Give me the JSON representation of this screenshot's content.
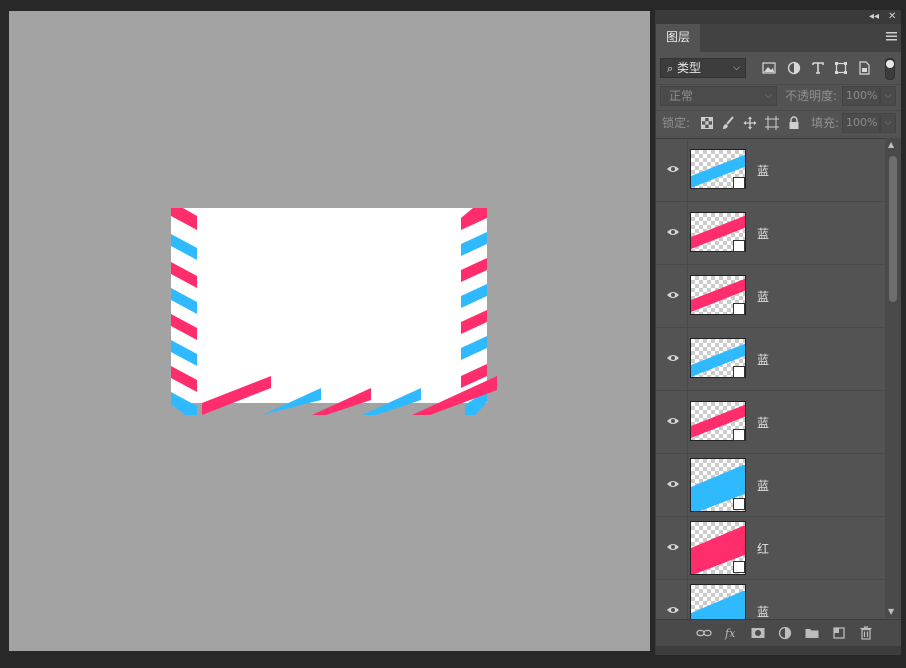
{
  "panel": {
    "topbar": {
      "collapse_glyph": "◂◂",
      "close_glyph": "✕"
    },
    "tab_label": "图层",
    "filter": {
      "kind_label": "类型",
      "icons": [
        "image-filter-icon",
        "adjustment-filter-icon",
        "text-filter-icon",
        "shape-filter-icon",
        "smart-object-filter-icon"
      ]
    },
    "blend": {
      "mode": "正常",
      "opacity_label": "不透明度:",
      "opacity_value": "100%"
    },
    "lock": {
      "label": "锁定:",
      "fill_label": "填充:",
      "fill_value": "100%"
    },
    "layers": [
      {
        "name": "蓝",
        "color": "blue"
      },
      {
        "name": "蓝",
        "color": "red"
      },
      {
        "name": "蓝",
        "color": "red"
      },
      {
        "name": "蓝",
        "color": "blue"
      },
      {
        "name": "蓝",
        "color": "red"
      },
      {
        "name": "蓝",
        "color": "blue"
      },
      {
        "name": "红",
        "color": "red"
      },
      {
        "name": "蓝",
        "color": "blue"
      }
    ],
    "bottom_icons": [
      "link-layers-icon",
      "fx-icon",
      "layer-mask-icon",
      "adjustment-layer-icon",
      "group-folder-icon",
      "new-layer-icon",
      "trash-icon"
    ]
  },
  "colors": {
    "stripe_red": "#ff2d6b",
    "stripe_blue": "#2fbaff",
    "canvas_bg": "#a3a3a3",
    "panel_bg": "#535353"
  }
}
